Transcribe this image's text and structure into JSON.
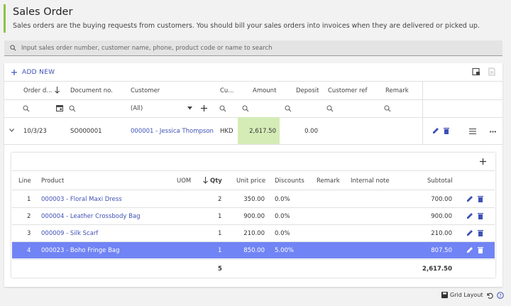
{
  "page": {
    "title": "Sales Order",
    "subtitle": "Sales orders are the buying requests from customers. You should bill your sales orders into invoices when they are delivered or picked up.",
    "search_placeholder": "Input sales order number, customer name, phone, product code or name to search",
    "add_new_label": "ADD NEW"
  },
  "orders_table": {
    "columns": {
      "order_date": "Order d...",
      "document_no": "Document no.",
      "customer": "Customer",
      "currency": "Cu...",
      "amount": "Amount",
      "deposit": "Deposit",
      "customer_ref": "Customer ref",
      "remark": "Remark"
    },
    "customer_filter": "(All)",
    "row": {
      "order_date": "10/3/23",
      "document_no": "SO000001",
      "customer": "000001 - Jessica Thompson",
      "currency": "HKD",
      "amount": "2,617.50",
      "deposit": "0.00"
    }
  },
  "lines_table": {
    "columns": {
      "line": "Line",
      "product": "Product",
      "uom": "UOM",
      "qty": "Qty",
      "unit_price": "Unit price",
      "discounts": "Discounts",
      "remark": "Remark",
      "internal_note": "Internal note",
      "subtotal": "Subtotal"
    },
    "rows": [
      {
        "line": "1",
        "product": "000003 - Floral Maxi Dress",
        "qty": "2",
        "unit_price": "350.00",
        "discounts": "0.0%",
        "subtotal": "700.00"
      },
      {
        "line": "2",
        "product": "000004 - Leather Crossbody Bag",
        "qty": "1",
        "unit_price": "900.00",
        "discounts": "0.0%",
        "subtotal": "900.00"
      },
      {
        "line": "3",
        "product": "000009 - Silk Scarf",
        "qty": "1",
        "unit_price": "210.00",
        "discounts": "0.0%",
        "subtotal": "210.00"
      },
      {
        "line": "4",
        "product": "000023 - Boho Fringe Bag",
        "qty": "1",
        "unit_price": "850.00",
        "discounts": "5.00%",
        "subtotal": "807.50"
      }
    ],
    "totals": {
      "qty": "5",
      "subtotal": "2,617.50"
    }
  },
  "footer": {
    "grid_layout_label": "Grid Layout"
  },
  "colors": {
    "accent": "#3f51b5",
    "header_bar": "#8bc34a",
    "amount_highlight": "#d5ecb7",
    "selected_row": "#7184f5"
  },
  "icons": [
    "search-icon",
    "plus-icon",
    "export-icon",
    "report-icon",
    "calendar-icon",
    "sort-arrow-icon",
    "chevron-down-icon",
    "pencil-icon",
    "trash-icon",
    "menu-icon",
    "more-icon",
    "save-icon",
    "undo-icon",
    "help-icon"
  ]
}
